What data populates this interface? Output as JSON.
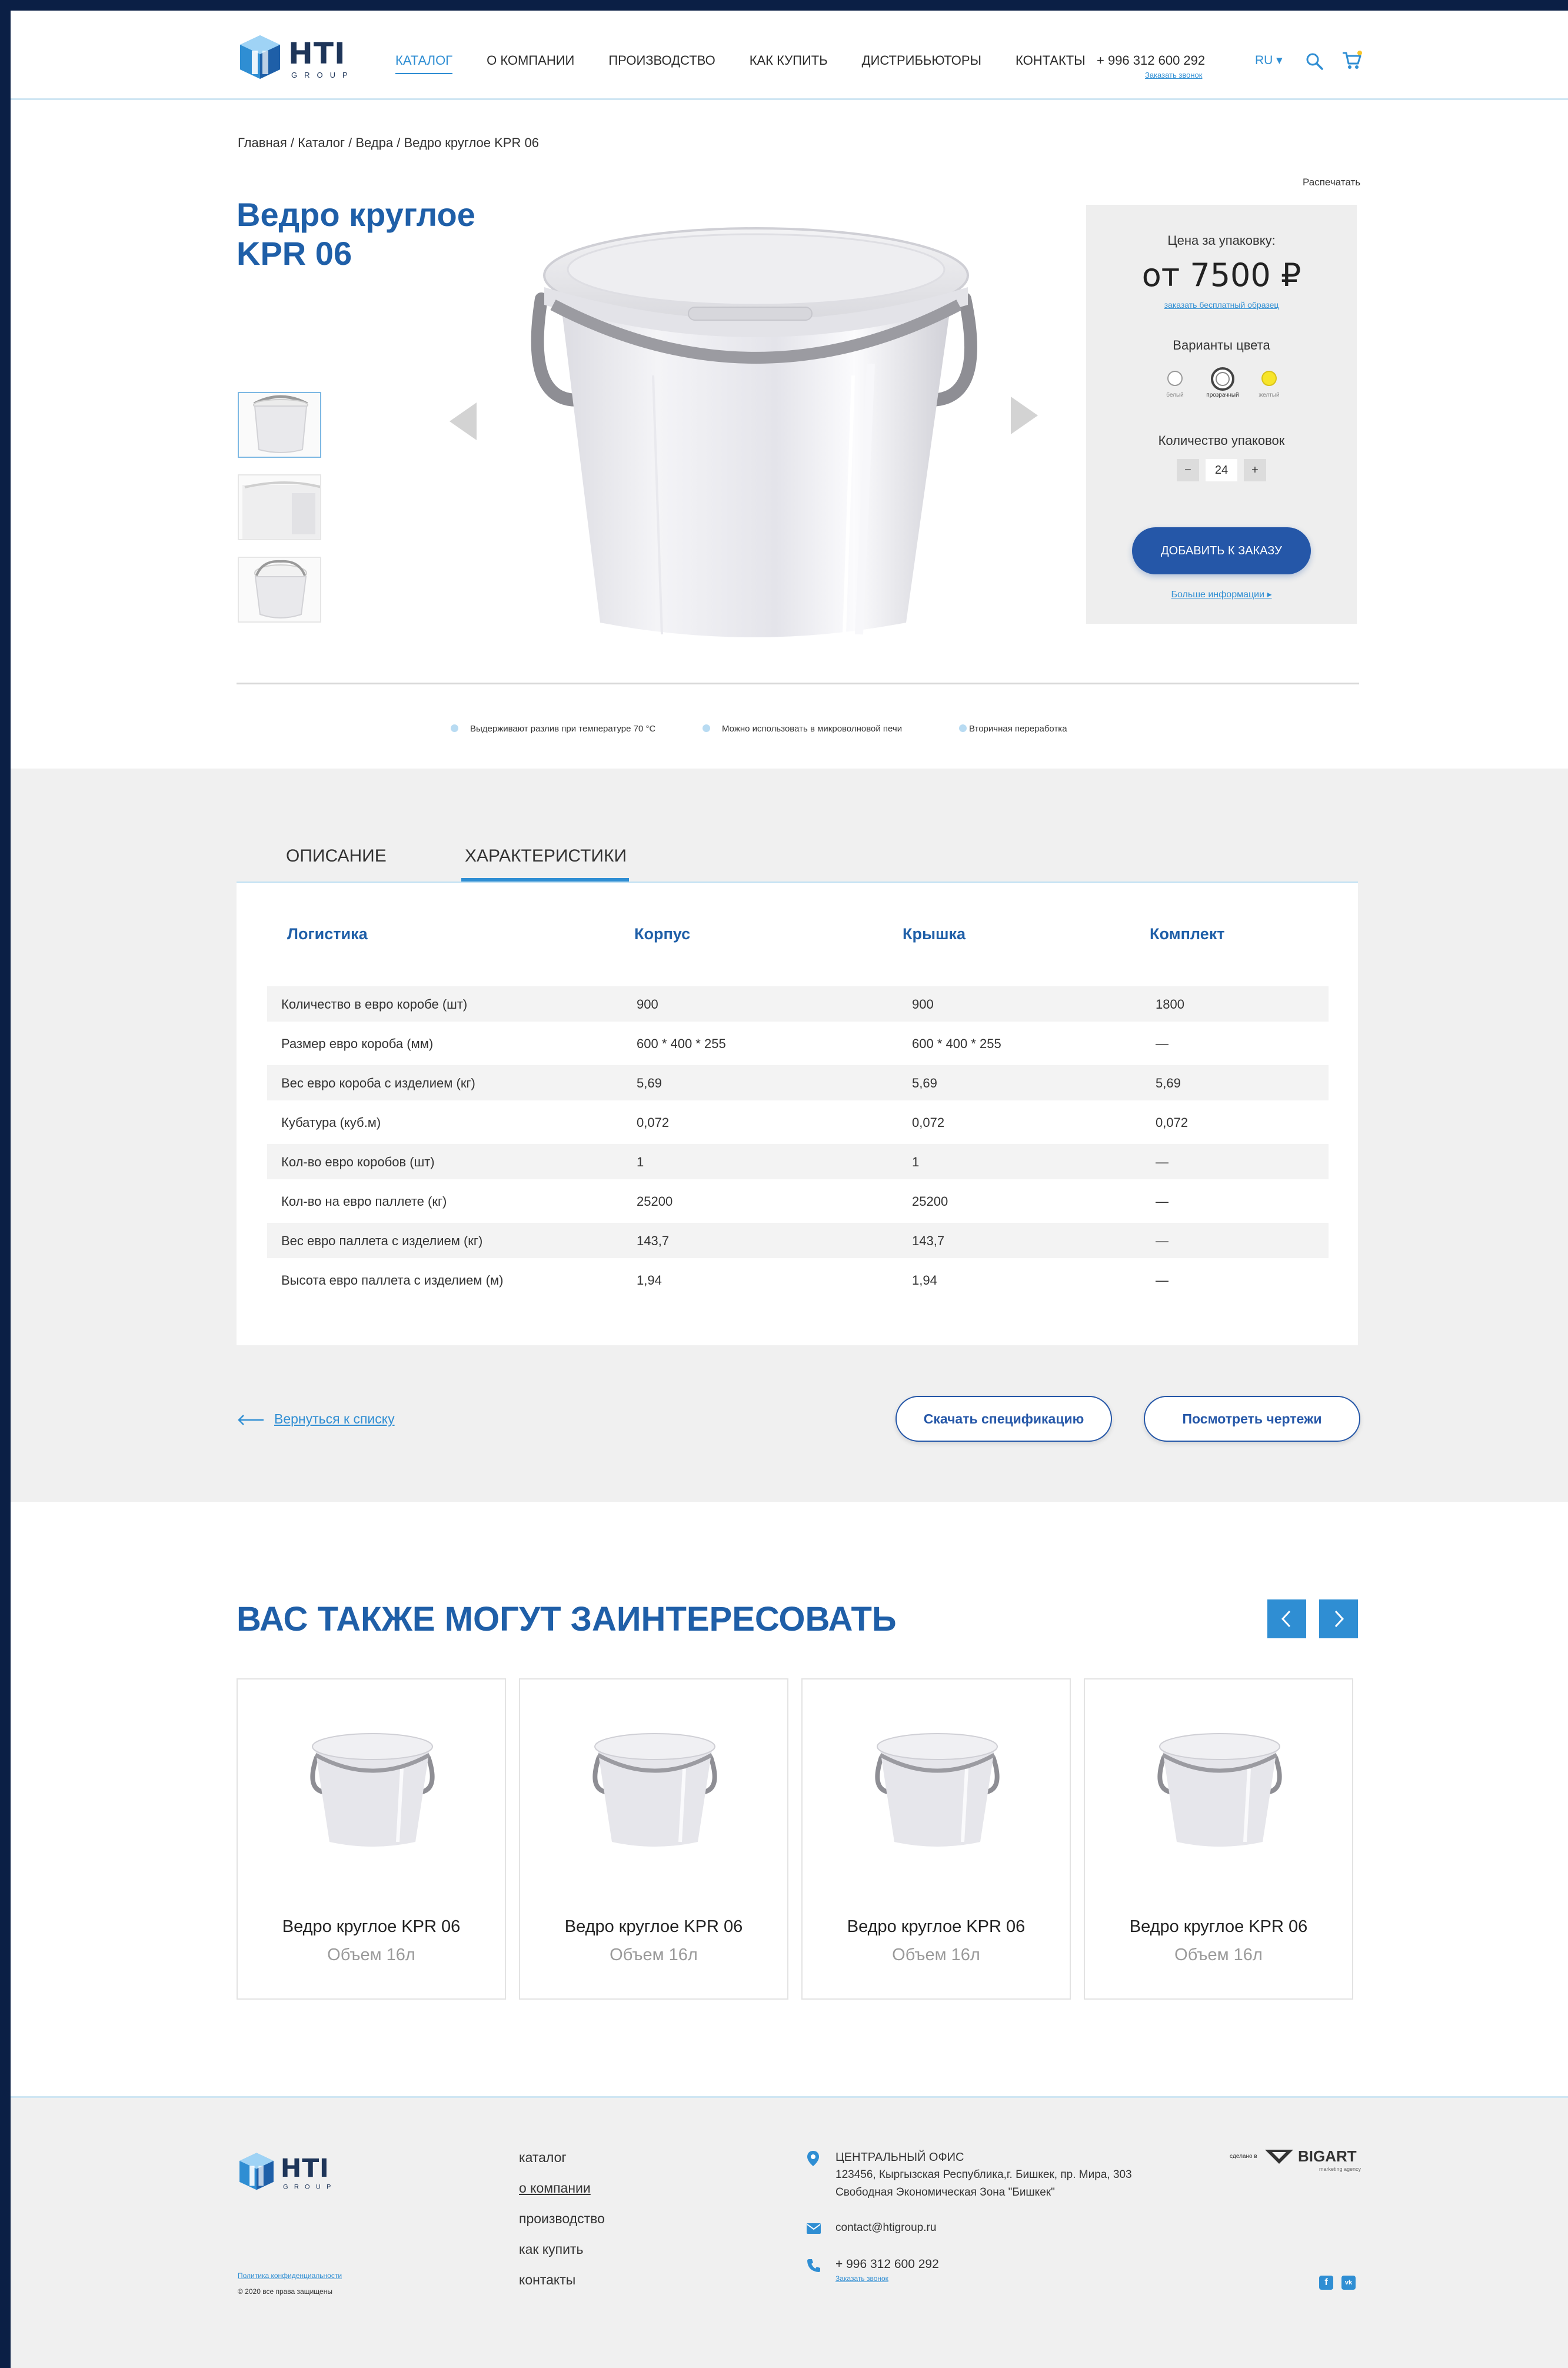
{
  "header": {
    "logo_text": "HTI",
    "logo_sub": "GROUP",
    "nav": [
      "КАТАЛОГ",
      "О КОМПАНИИ",
      "ПРОИЗВОДСТВО",
      "КАК КУПИТЬ",
      "ДИСТРИБЬЮТОРЫ",
      "КОНТАКТЫ"
    ],
    "phone": "+ 996 312 600 292",
    "phone_sub": "Заказать звонок",
    "lang": "RU ▾"
  },
  "breadcrumb": "Главная / Каталог / Ведра / Ведро круглое KPR 06",
  "print_label": "Распечатать",
  "product": {
    "title": "Ведро круглое KPR 06"
  },
  "price_box": {
    "price_label": "Цена за упаковку:",
    "price": "от 7500 ₽",
    "sample_link": "заказать бесплатный образец",
    "color_label": "Варианты цвета",
    "colors": [
      {
        "name": "белый",
        "hex": "#ffffff"
      },
      {
        "name": "прозрачный",
        "hex": "#f4f4f4"
      },
      {
        "name": "желтый",
        "hex": "#f7e52a"
      }
    ],
    "qty_label": "Количество упаковок",
    "qty_minus": "−",
    "qty_value": "24",
    "qty_plus": "+",
    "add_button": "Добавить к заказу",
    "more_info": "Больше информации  ▸"
  },
  "features": [
    "Выдерживают разлив при температуре 70 °С",
    "Можно использовать в микроволновой печи",
    "Вторичная переработка"
  ],
  "tabs": [
    "Описание",
    "Характеристики"
  ],
  "spec_table": {
    "headers": [
      "Логистика",
      "Корпус",
      "Крышка",
      "Комплект"
    ],
    "rows": [
      [
        "Количество в евро коробе (шт)",
        "900",
        "900",
        "1800"
      ],
      [
        "Размер евро короба (мм)",
        "600 * 400 * 255",
        "600 * 400 * 255",
        "—"
      ],
      [
        "Вес евро короба с изделием (кг)",
        "5,69",
        "5,69",
        "5,69"
      ],
      [
        "Кубатура (куб.м)",
        "0,072",
        "0,072",
        "0,072"
      ],
      [
        "Кол-во евро коробов (шт)",
        "1",
        "1",
        "—"
      ],
      [
        "Кол-во на евро паллете (кг)",
        "25200",
        "25200",
        "—"
      ],
      [
        "Вес евро  паллета с изделием (кг)",
        "143,7",
        "143,7",
        "—"
      ],
      [
        "Высота евро паллета с изделием (м)",
        "1,94",
        "1,94",
        "—"
      ]
    ]
  },
  "actions": {
    "back": "Вернуться к списку",
    "download": "Скачать спецификацию",
    "drawings": "Посмотреть чертежи"
  },
  "related": {
    "title": "Вас также могут заинтересовать",
    "prev": "‹",
    "next": "›",
    "items": [
      {
        "name": "Ведро круглое KPR 06",
        "volume": "Объем 16л"
      },
      {
        "name": "Ведро круглое KPR 06",
        "volume": "Объем 16л"
      },
      {
        "name": "Ведро круглое KPR 06",
        "volume": "Объем 16л"
      },
      {
        "name": "Ведро круглое KPR 06",
        "volume": "Объем 16л"
      }
    ]
  },
  "footer": {
    "links": [
      "каталог",
      "о компании",
      "производство",
      "как купить",
      "контакты"
    ],
    "privacy": "Политика конфиденциальности",
    "copyright": "© 2020 все права защищены",
    "office_title": "ЦЕНТРАЛЬНЫЙ ОФИС",
    "address_line1": "123456, Кыргызская Республика,г. Бишкек, пр. Мира, 303",
    "address_line2": "Свободная Экономическая Зона \"Бишкек\"",
    "email": "contact@htigroup.ru",
    "phone": "+ 996  312  600  292",
    "phone_sub": "Заказать звонок",
    "dev_label": "сделано в",
    "dev_brand": "BIGART",
    "dev_sub": "marketing agency",
    "social": [
      "f",
      "vk"
    ]
  },
  "colors": {
    "accent": "#2f8ed3",
    "brand_dark": "#2557a8",
    "title_blue": "#1f5fa8",
    "frame": "#0b1f45"
  }
}
